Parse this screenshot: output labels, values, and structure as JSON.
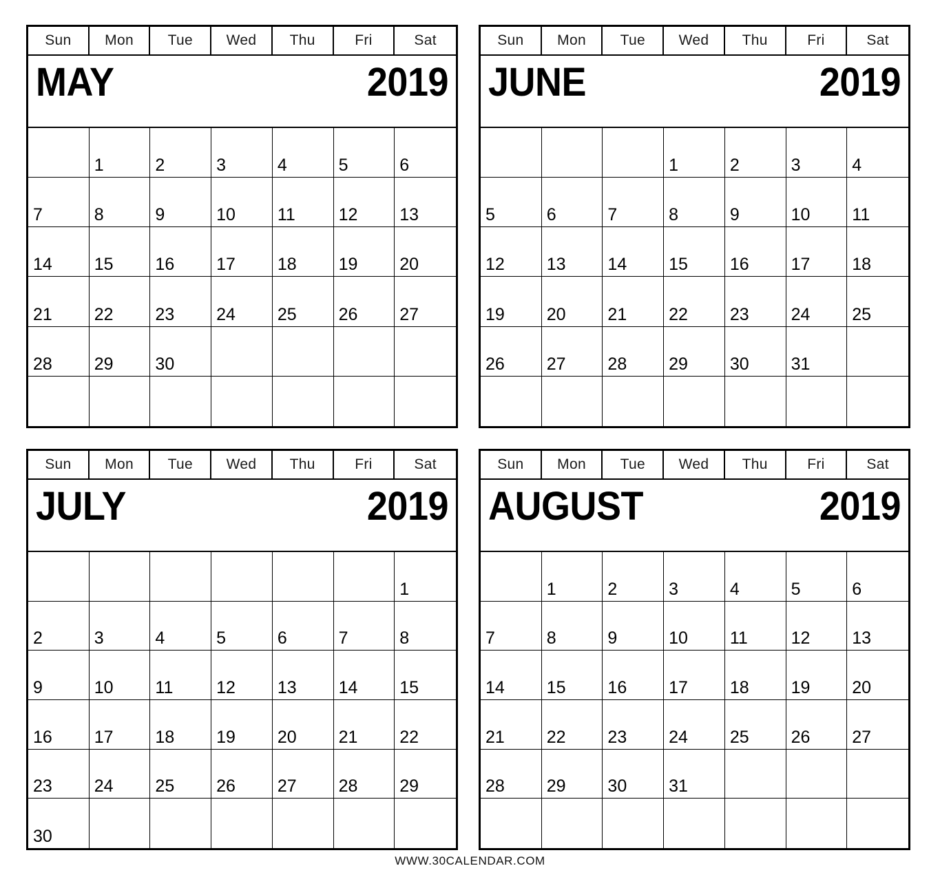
{
  "page": {
    "background_color": "#ffffff",
    "text_color": "#000000",
    "border_color": "#000000"
  },
  "footer": {
    "text": "WWW.30CALENDAR.COM"
  },
  "weekday_headers": [
    "Sun",
    "Mon",
    "Tue",
    "Wed",
    "Thu",
    "Fri",
    "Sat"
  ],
  "months": [
    {
      "name": "MAY",
      "year": "2019",
      "start_weekday_index": 1,
      "num_days": 30,
      "weeks": [
        [
          "",
          "1",
          "2",
          "3",
          "4",
          "5",
          "6"
        ],
        [
          "7",
          "8",
          "9",
          "10",
          "11",
          "12",
          "13"
        ],
        [
          "14",
          "15",
          "16",
          "17",
          "18",
          "19",
          "20"
        ],
        [
          "21",
          "22",
          "23",
          "24",
          "25",
          "26",
          "27"
        ],
        [
          "28",
          "29",
          "30",
          "",
          "",
          "",
          ""
        ],
        [
          "",
          "",
          "",
          "",
          "",
          "",
          ""
        ]
      ]
    },
    {
      "name": "JUNE",
      "year": "2019",
      "start_weekday_index": 3,
      "num_days": 31,
      "weeks": [
        [
          "",
          "",
          "",
          "1",
          "2",
          "3",
          "4"
        ],
        [
          "5",
          "6",
          "7",
          "8",
          "9",
          "10",
          "11"
        ],
        [
          "12",
          "13",
          "14",
          "15",
          "16",
          "17",
          "18"
        ],
        [
          "19",
          "20",
          "21",
          "22",
          "23",
          "24",
          "25"
        ],
        [
          "26",
          "27",
          "28",
          "29",
          "30",
          "31",
          ""
        ],
        [
          "",
          "",
          "",
          "",
          "",
          "",
          ""
        ]
      ]
    },
    {
      "name": "JULY",
      "year": "2019",
      "start_weekday_index": 6,
      "num_days": 30,
      "weeks": [
        [
          "",
          "",
          "",
          "",
          "",
          "",
          "1"
        ],
        [
          "2",
          "3",
          "4",
          "5",
          "6",
          "7",
          "8"
        ],
        [
          "9",
          "10",
          "11",
          "12",
          "13",
          "14",
          "15"
        ],
        [
          "16",
          "17",
          "18",
          "19",
          "20",
          "21",
          "22"
        ],
        [
          "23",
          "24",
          "25",
          "26",
          "27",
          "28",
          "29"
        ],
        [
          "30",
          "",
          "",
          "",
          "",
          "",
          ""
        ]
      ]
    },
    {
      "name": "AUGUST",
      "year": "2019",
      "start_weekday_index": 1,
      "num_days": 31,
      "weeks": [
        [
          "",
          "1",
          "2",
          "3",
          "4",
          "5",
          "6"
        ],
        [
          "7",
          "8",
          "9",
          "10",
          "11",
          "12",
          "13"
        ],
        [
          "14",
          "15",
          "16",
          "17",
          "18",
          "19",
          "20"
        ],
        [
          "21",
          "22",
          "23",
          "24",
          "25",
          "26",
          "27"
        ],
        [
          "28",
          "29",
          "30",
          "31",
          "",
          "",
          ""
        ],
        [
          "",
          "",
          "",
          "",
          "",
          "",
          ""
        ]
      ]
    }
  ]
}
